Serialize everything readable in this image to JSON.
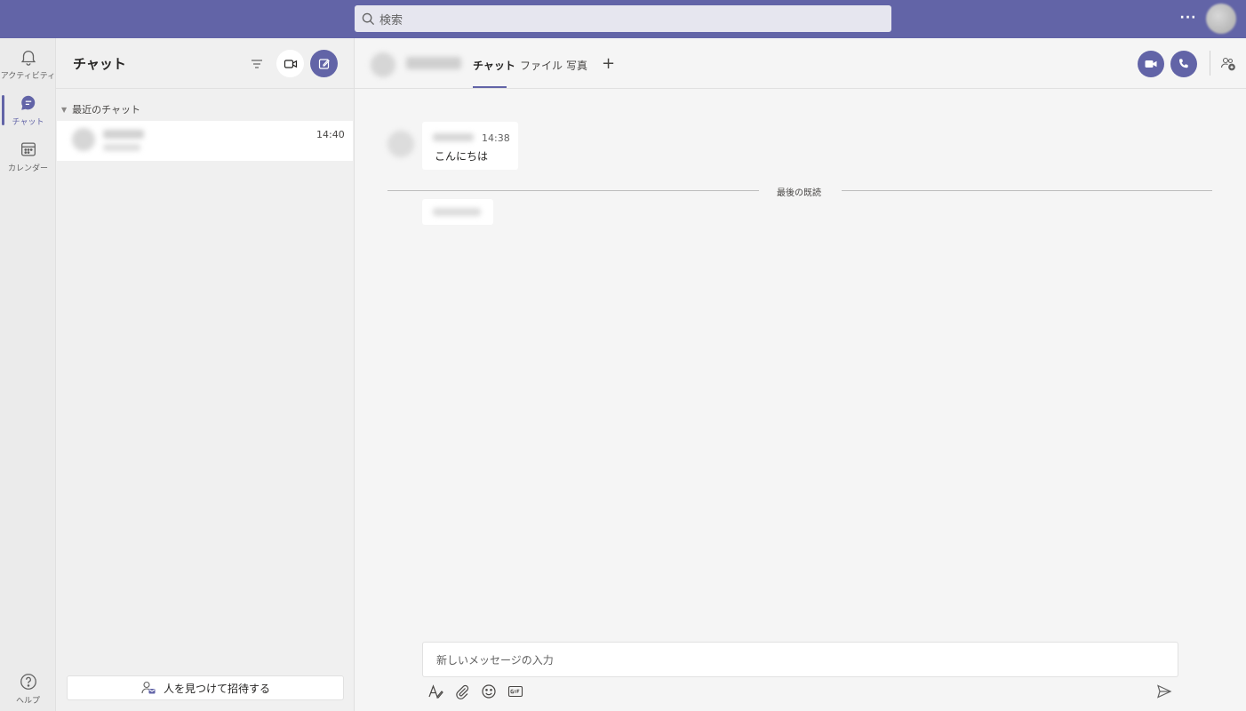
{
  "topbar": {
    "search_placeholder": "検索",
    "more_label": "···"
  },
  "rail": {
    "items": [
      {
        "label": "アクティビティ",
        "icon": "bell-icon"
      },
      {
        "label": "チャット",
        "icon": "chat-icon"
      },
      {
        "label": "カレンダー",
        "icon": "calendar-icon"
      }
    ],
    "help_label": "ヘルプ"
  },
  "chatlist": {
    "title": "チャット",
    "section_label": "最近のチャット",
    "items": [
      {
        "time": "14:40"
      }
    ],
    "invite_label": "人を見つけて招待する"
  },
  "main": {
    "tabs": [
      {
        "label": "チャット"
      },
      {
        "label": "ファイル"
      },
      {
        "label": "写真"
      }
    ],
    "add_tab": "+",
    "messages": [
      {
        "time": "14:38",
        "text": "こんにちは"
      }
    ],
    "last_read_label": "最後の既読",
    "compose_placeholder": "新しいメッセージの入力"
  },
  "colors": {
    "brand": "#6264a7",
    "background": "#f5f5f5"
  }
}
